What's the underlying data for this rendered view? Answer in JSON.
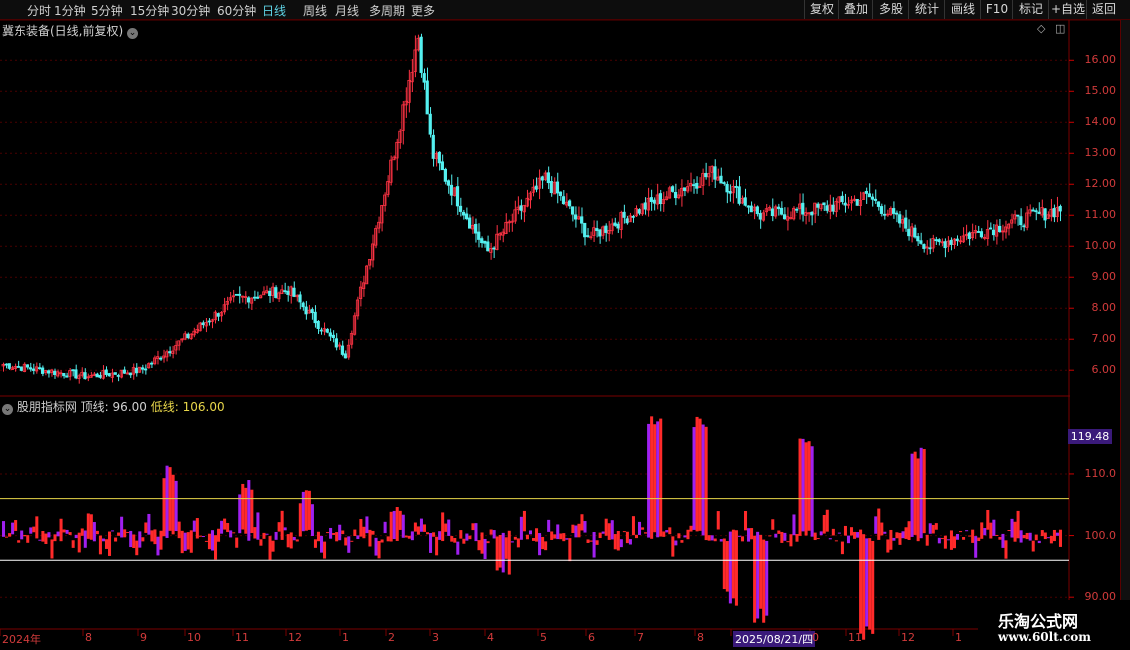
{
  "toolbar": {
    "tabs": [
      "分时",
      "1分钟",
      "5分钟",
      "15分钟",
      "30分钟",
      "60分钟",
      "日线",
      "周线",
      "月线",
      "多周期",
      "更多"
    ],
    "active_tab": "日线",
    "right_buttons": [
      "复权",
      "叠加",
      "多股",
      "统计",
      "画线",
      "F10",
      "标记",
      "+自选",
      "返回"
    ]
  },
  "main_chart": {
    "title": "冀东装备(日线,前复权)",
    "y_ticks": [
      "16.00",
      "15.00",
      "14.00",
      "13.00",
      "12.00",
      "11.00",
      "10.00",
      "9.00",
      "8.00",
      "7.00",
      "6.00"
    ]
  },
  "indicator": {
    "name": "股朋指标网",
    "top_label": "顶线:",
    "top_value": "96.00",
    "low_label": "低线:",
    "low_value": "106.00",
    "current_value": "119.48",
    "y_ticks": [
      "110.0",
      "100.0",
      "90.00"
    ]
  },
  "x_axis": {
    "labels": [
      "2024年",
      "8",
      "9",
      "10",
      "11",
      "12",
      "1",
      "2",
      "3",
      "4",
      "5",
      "6",
      "7",
      "8",
      "2025/08/21/四",
      "0",
      "11",
      "12",
      "1"
    ]
  },
  "watermark": {
    "line1": "乐淘公式网",
    "line2": "www.60lt.com"
  },
  "colors": {
    "up": "#ff3344",
    "down": "#54f0f0",
    "indicator_red": "#ff2a2a",
    "indicator_purple": "#a020f0",
    "top_line": "#ffffff",
    "low_line": "#e8d64a",
    "active_tab": "#5fd3e6"
  },
  "chart_data": [
    {
      "type": "candlestick",
      "title": "冀东装备(日线,前复权)",
      "ylim": [
        5.2,
        17.3
      ],
      "x_months": [
        "2024年",
        "8",
        "9",
        "10",
        "11",
        "12",
        "1",
        "2",
        "3",
        "4",
        "5",
        "6",
        "7",
        "8",
        "9",
        "10",
        "11",
        "12",
        "1"
      ],
      "key_points": [
        {
          "x": "2024年",
          "y": 6.2
        },
        {
          "x": "8",
          "y": 5.8
        },
        {
          "x": "9",
          "y": 6.0
        },
        {
          "x": "10",
          "y": 7.1
        },
        {
          "x": "11",
          "y": 8.3
        },
        {
          "x": "12",
          "y": 8.6
        },
        {
          "x": "1",
          "y": 6.5
        },
        {
          "x": "2",
          "y": 12.5
        },
        {
          "x": "2-peak",
          "y": 16.8
        },
        {
          "x": "3",
          "y": 13.0
        },
        {
          "x": "4",
          "y": 9.8
        },
        {
          "x": "5",
          "y": 12.2
        },
        {
          "x": "6",
          "y": 10.3
        },
        {
          "x": "7",
          "y": 11.2
        },
        {
          "x": "8",
          "y": 12.4
        },
        {
          "x": "9",
          "y": 11.0
        },
        {
          "x": "10",
          "y": 11.2
        },
        {
          "x": "11",
          "y": 11.6
        },
        {
          "x": "12",
          "y": 10.0
        },
        {
          "x": "1",
          "y": 11.2
        }
      ]
    },
    {
      "type": "bar",
      "title": "股朋指标网",
      "ylim": [
        85,
        122
      ],
      "reference_lines": [
        96.0,
        106.0
      ],
      "last_value": 119.48
    }
  ]
}
